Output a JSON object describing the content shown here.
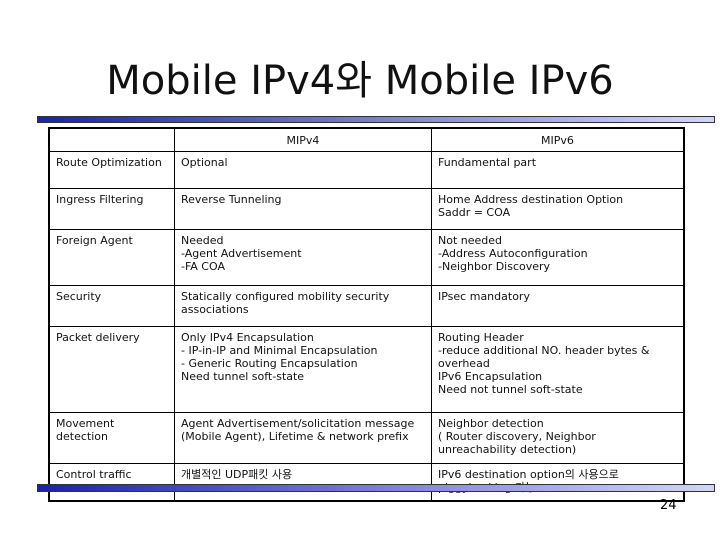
{
  "title": "Mobile IPv4와 Mobile IPv6",
  "table": {
    "headers": [
      "",
      "MIPv4",
      "MIPv6"
    ],
    "rows": [
      {
        "feature": "Route Optimization",
        "mipv4": [
          "Optional"
        ],
        "mipv6": [
          "Fundamental part"
        ]
      },
      {
        "feature": "Ingress Filtering",
        "mipv4": [
          "Reverse Tunneling"
        ],
        "mipv6": [
          "Home Address destination Option",
          "Saddr = COA"
        ]
      },
      {
        "feature": "Foreign Agent",
        "mipv4": [
          "Needed",
          "-Agent Advertisement",
          "-FA COA"
        ],
        "mipv6": [
          "Not needed",
          "-Address Autoconfiguration",
          "-Neighbor Discovery"
        ]
      },
      {
        "feature": "Security",
        "mipv4": [
          "Statically configured mobility security",
          "associations"
        ],
        "mipv6": [
          "IPsec mandatory"
        ]
      },
      {
        "feature": "Packet delivery",
        "mipv4": [
          "Only IPv4 Encapsulation",
          "- IP-in-IP and Minimal Encapsulation",
          "- Generic Routing Encapsulation",
          "Need tunnel soft-state"
        ],
        "mipv6": [
          "Routing Header",
          "-reduce additional NO. header bytes &",
          "overhead",
          "IPv6 Encapsulation",
          "Need not tunnel soft-state"
        ]
      },
      {
        "feature": "Movement detection",
        "mipv4": [
          "Agent Advertisement/solicitation message",
          "(Mobile Agent), Lifetime & network prefix"
        ],
        "mipv6": [
          "Neighbor detection",
          "( Router discovery,  Neighbor",
          "unreachability detection)"
        ]
      },
      {
        "feature": "Control traffic",
        "mipv4": [
          "개별적인 UDP패킷 사용"
        ],
        "mipv6": [
          "IPv6 destination option의 사용으로",
          "piggybacking 가능"
        ]
      }
    ]
  },
  "page_number": "24"
}
